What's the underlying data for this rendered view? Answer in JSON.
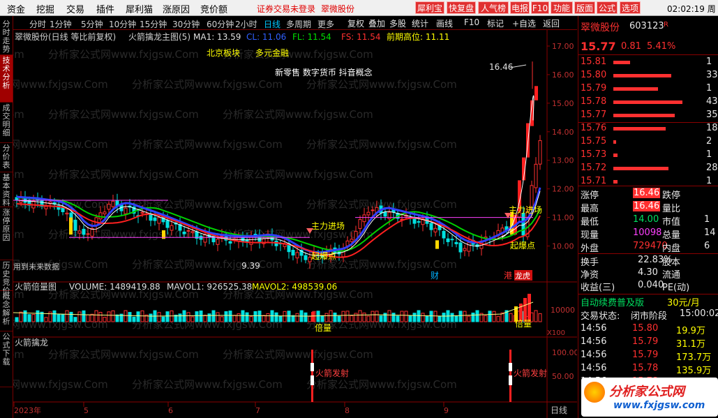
{
  "menu": {
    "items": [
      "资金",
      "挖掘",
      "交易",
      "插件",
      "犀利猫",
      "涨原因",
      "竞价额"
    ],
    "status": "证券交易未登录",
    "stock": "翠微股份",
    "red_buttons": [
      "犀利宝",
      "快复盘",
      "人气榜",
      "电报",
      "F10",
      "功能",
      "版面",
      "公式",
      "选项"
    ],
    "time": "02:02:19 周五"
  },
  "left_tabs": [
    "分时走势",
    "技术分析",
    "成交明细",
    "分价表",
    "基本资料",
    "涨停原因",
    "历史竞价",
    "概念解析",
    "公式下载"
  ],
  "toolbar": {
    "periods": [
      "分时",
      "1分钟",
      "5分钟",
      "10分钟",
      "15分钟",
      "30分钟",
      "60分钟",
      "2小时",
      "日线",
      "多周期",
      "更多"
    ],
    "selected": "日线",
    "right": [
      "复权",
      "叠加",
      "多股",
      "统计",
      "画线",
      "F10",
      "标记",
      "+自选",
      "返回"
    ]
  },
  "main": {
    "title": "翠微股份(日线 等比前复权)",
    "indicator": "火箭擒龙主图(5)",
    "ma1": "MA1: 13.59",
    "cl": "CL: 11.06",
    "fl": "FL: 11.54",
    "fs": "FS: 11.54",
    "prev_high": "前期高位: 11.11",
    "tags": [
      "北京板块",
      "多元金融"
    ],
    "concepts": "新零售 数字货币 抖音概念",
    "yaxis": [
      "17.00",
      "16.00",
      "15.00",
      "14.00",
      "13.00",
      "12.00",
      "11.00",
      "10.00"
    ],
    "high_label": "16.46",
    "low_label": "9.39",
    "ann_zhuli1": "主力进场",
    "ann_zhuli2": "主力进场",
    "ann_bao1": "起爆点",
    "ann_bao2": "起爆点",
    "future": "用到未来数据",
    "cai": "财",
    "gang": "港",
    "rank": "龙虎"
  },
  "vol": {
    "title": "火箭倍量图",
    "volume": "VOLUME: 1489419.88",
    "mavol1": "MAVOL1: 926525.38",
    "mavol2": "MAVOL2: 498539.06",
    "yaxis": "10000",
    "unit": "X100",
    "beiliang1": "倍量",
    "beiliang2": "倍量"
  },
  "rocket": {
    "title": "火箭擒龙",
    "yaxis": [
      "100.00",
      "50.00"
    ],
    "signal1": "火箭发射",
    "signal2": "火箭发射"
  },
  "xaxis": {
    "labels": [
      "2023年",
      "5",
      "6",
      "7",
      "8",
      "9"
    ],
    "period": "日线"
  },
  "watermark": "分析家公式网www.fxjgsw.Com",
  "quote": {
    "name": "翠微股份",
    "code": "603123",
    "r": "R",
    "price": "15.77",
    "change": "0.81",
    "pct": "5.41%",
    "asks": [
      {
        "p": "15.81",
        "v": "1",
        "w": 0.22
      },
      {
        "p": "15.80",
        "v": "33",
        "w": 0.75
      },
      {
        "p": "15.79",
        "v": "1",
        "w": 0.58
      },
      {
        "p": "15.78",
        "v": "43",
        "w": 0.9
      },
      {
        "p": "15.77",
        "v": "35",
        "w": 0.8
      }
    ],
    "bids": [
      {
        "p": "15.76",
        "v": "18",
        "w": 0.68
      },
      {
        "p": "15.75",
        "v": "2",
        "w": 0.04
      },
      {
        "p": "15.73",
        "v": "1",
        "w": 0.05
      },
      {
        "p": "15.72",
        "v": "28",
        "w": 0.72
      },
      {
        "p": "15.71",
        "v": "1",
        "w": 0.05
      }
    ],
    "stats": [
      [
        "涨停",
        "16.46",
        "跌停",
        ""
      ],
      [
        "最高",
        "16.46",
        "量比",
        ""
      ],
      [
        "最低",
        "14.00",
        "市值",
        "1"
      ],
      [
        "现量",
        "10098",
        "总量",
        "14"
      ],
      [
        "外盘",
        "729470",
        "内盘",
        "6"
      ]
    ],
    "stats2": [
      [
        "换手",
        "22.83%",
        "股本",
        ""
      ],
      [
        "净资",
        "4.30",
        "流通",
        ""
      ],
      [
        "收益(三)",
        "0.040",
        "PE(动)",
        ""
      ]
    ],
    "promo": "自动续费普及版",
    "promo_price": "30元/月",
    "state_label": "交易状态:",
    "state_val": "闭市阶段",
    "state_time": "15:00:02",
    "ticks": [
      {
        "t": "14:56",
        "p": "15.80",
        "v": "19.9万"
      },
      {
        "t": "14:56",
        "p": "15.79",
        "v": "31.1万"
      },
      {
        "t": "14:56",
        "p": "15.79",
        "v": "173.7万"
      },
      {
        "t": "14:56",
        "p": "15.78",
        "v": "135.9万"
      },
      {
        "t": "14:56",
        "p": "15.78",
        "v": ""
      }
    ],
    "logo": "分析家公式网",
    "logo_url": "www.fxjgsw.com"
  },
  "chart_data": {
    "type": "candlestick",
    "ylim": [
      9,
      17.5
    ],
    "high": 16.46,
    "low": 9.39,
    "last": 15.77,
    "xlabels": [
      "2023年",
      "5",
      "6",
      "7",
      "8",
      "9"
    ]
  }
}
